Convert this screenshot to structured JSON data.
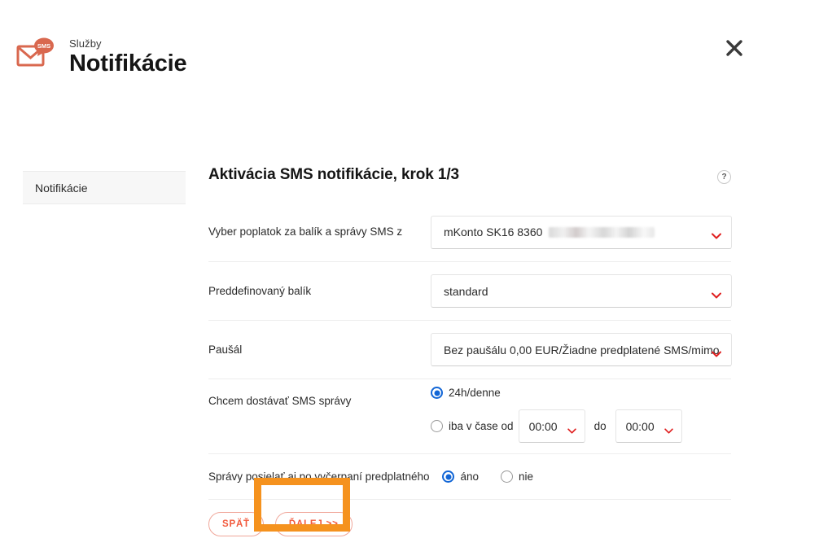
{
  "header": {
    "kicker": "Služby",
    "title": "Notifikácie",
    "brand_icon": "sms-envelope-icon",
    "brand_badge": "SMS",
    "close_icon": "close-icon"
  },
  "sidebar": {
    "items": [
      {
        "label": "Notifikácie"
      }
    ]
  },
  "main": {
    "section_title": "Aktivácia SMS notifikácie, krok 1/3",
    "help_icon_label": "?",
    "rows": {
      "account": {
        "label": "Vyber poplatok za balík a správy SMS z",
        "value": "mKonto SK16 8360",
        "redacted": true,
        "caret_icon": "chevron-down-icon"
      },
      "package": {
        "label": "Preddefinovaný balík",
        "value": "standard",
        "caret_icon": "chevron-down-icon"
      },
      "flatrate": {
        "label": "Paušál",
        "value": "Bez paušálu 0,00 EUR/Žiadne predplatené SMS/mimo",
        "caret_icon": "chevron-down-icon"
      },
      "delivery": {
        "label": "Chcem dostávať SMS správy",
        "option_allday": "24h/denne",
        "option_timerange": "iba v čase od",
        "between_label": "do",
        "time_from": "00:00",
        "time_to": "00:00",
        "selected": "allday"
      },
      "after_credit": {
        "label": "Správy posielať aj po vyčerpaní predplatného",
        "option_yes": "áno",
        "option_no": "nie",
        "selected": "yes"
      }
    },
    "actions": {
      "back_label": "SPÄŤ",
      "next_label": "ĎALEJ >>"
    }
  },
  "annotation": {
    "highlight_color": "#f5921e",
    "highlight_target": "ĎALEJ >>"
  },
  "colors": {
    "accent_red": "#e8412b",
    "brand_orange": "#d9684f",
    "radio_blue": "#1266d6",
    "button_red": "#f2593c",
    "highlight_orange": "#f5921e"
  }
}
